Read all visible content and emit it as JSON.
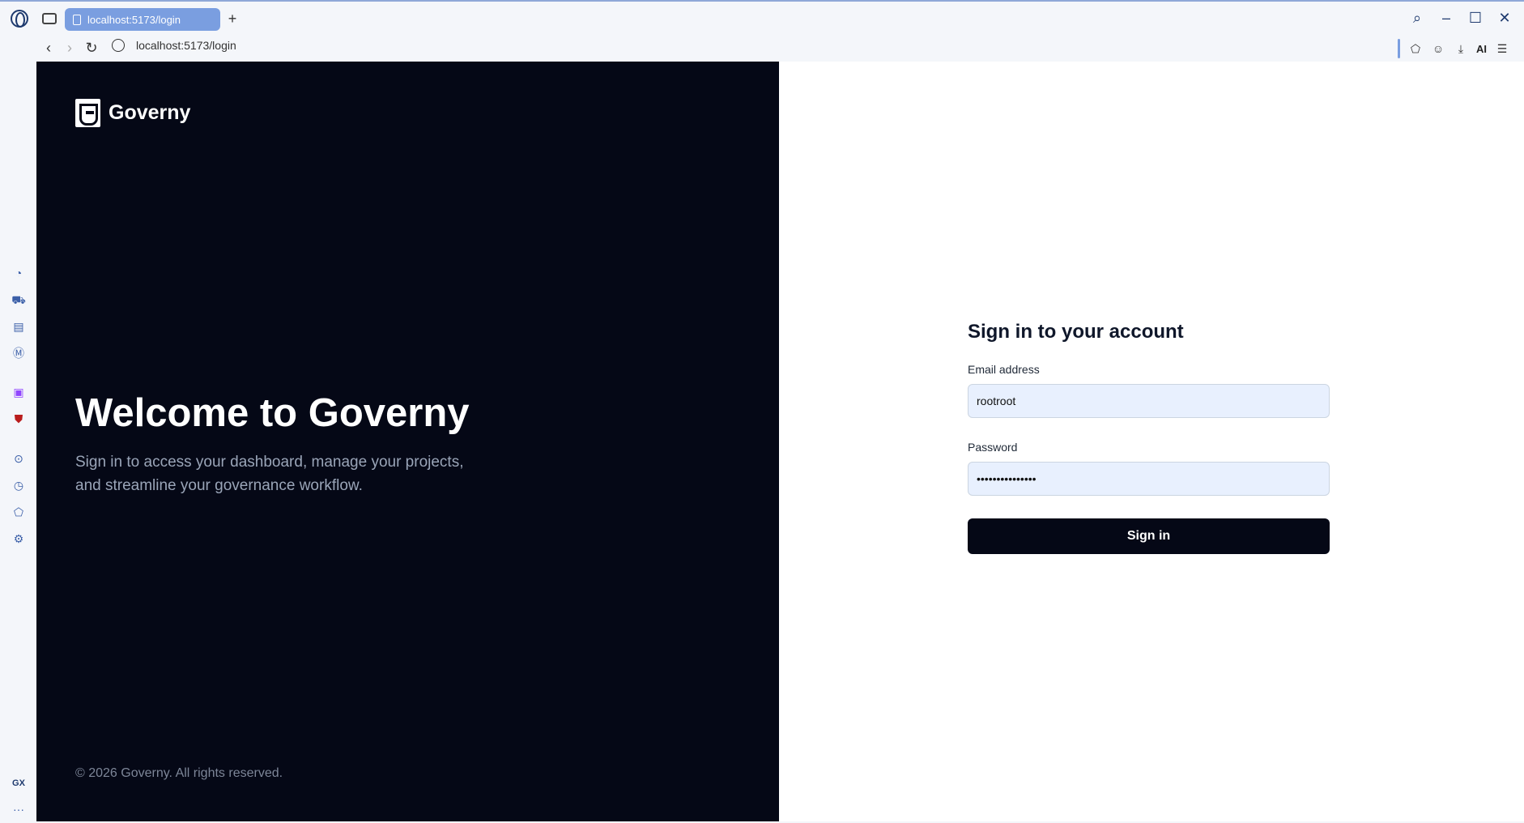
{
  "browser": {
    "tab_title": "localhost:5173/login",
    "new_tab": "+",
    "url": "localhost:5173/login",
    "ai_label": "AI",
    "sidebar_gx": "GX",
    "sidebar_more": "···"
  },
  "brand": {
    "name": "Governy"
  },
  "hero": {
    "title": "Welcome to Governy",
    "subtitle": "Sign in to access your dashboard, manage your projects, and streamline your governance workflow."
  },
  "footer": {
    "copyright": "© 2026 Governy. All rights reserved."
  },
  "form": {
    "title": "Sign in to your account",
    "email_label": "Email address",
    "email_value": "rootroot",
    "password_label": "Password",
    "password_value": "•••••••••••••••",
    "submit_label": "Sign in"
  },
  "colors": {
    "dark_panel": "#050816",
    "accent_tab": "#7a9ee0",
    "input_bg": "#e8f0fe"
  },
  "icons": {
    "sidebar": [
      "speed-dial-icon",
      "shopping-icon",
      "news-icon",
      "messenger-icon",
      "twitch-icon",
      "ublock-icon",
      "player-icon",
      "history-icon",
      "extensions-icon",
      "settings-icon"
    ]
  }
}
